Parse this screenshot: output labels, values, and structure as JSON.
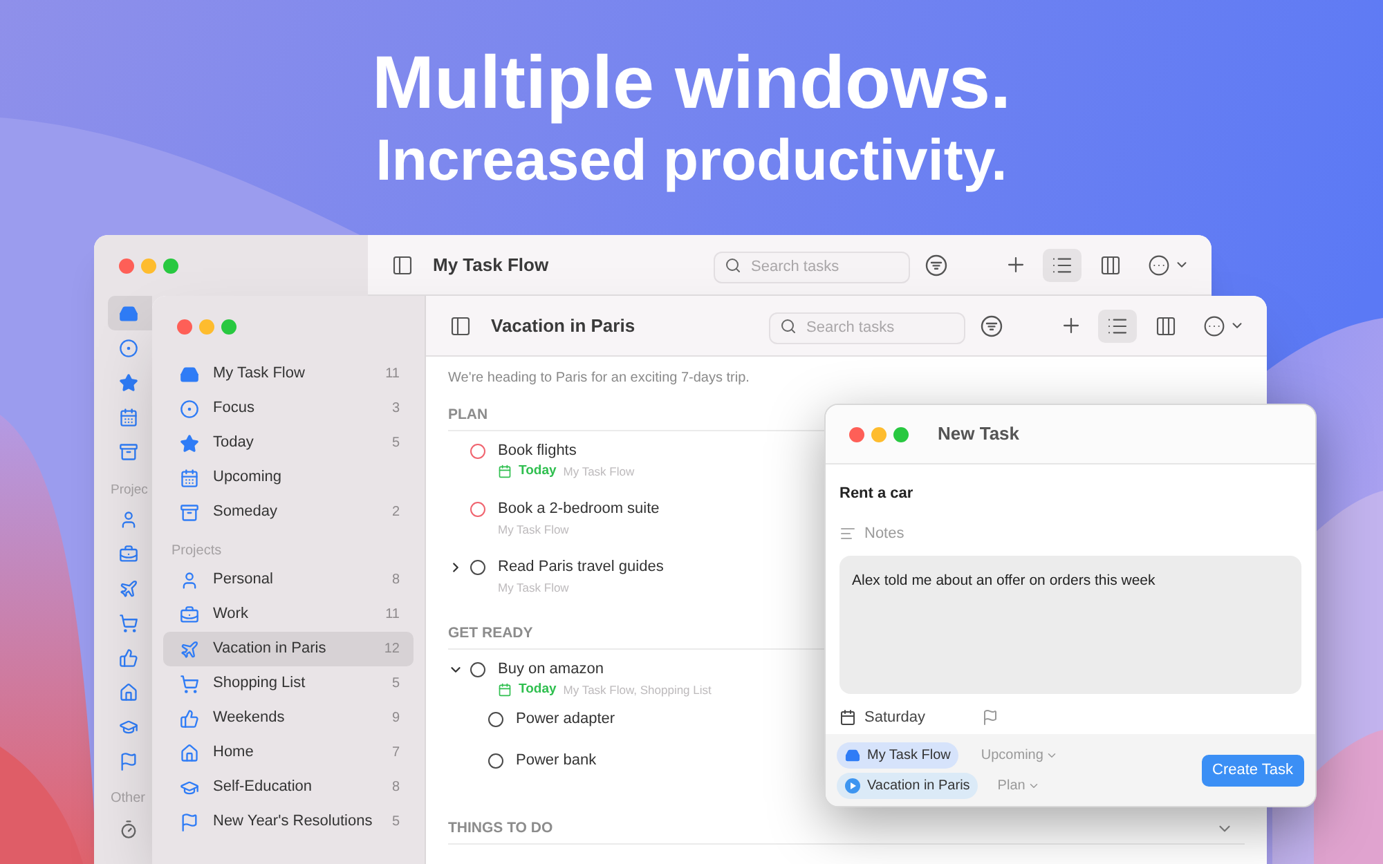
{
  "headline": {
    "title": "Multiple windows.",
    "subtitle": "Increased productivity."
  },
  "back_window": {
    "title": "My Task Flow",
    "search": {
      "placeholder": "Search tasks"
    },
    "views": [
      {
        "selected": true
      },
      {
        "selected": false
      }
    ],
    "sidebar": {
      "lists": [
        {
          "selected": true
        },
        {
          "selected": false
        },
        {
          "selected": false
        },
        {
          "selected": false
        },
        {
          "selected": false
        }
      ],
      "projects_label": "Projec",
      "projects": [
        {
          "selected": false
        },
        {
          "selected": false
        },
        {
          "selected": false
        },
        {
          "selected": false
        },
        {
          "selected": false
        },
        {
          "selected": false
        },
        {
          "selected": false
        },
        {
          "selected": false
        }
      ],
      "other_label": "Other",
      "other": [
        {
          "selected": false
        }
      ]
    }
  },
  "main_window": {
    "title": "Vacation in Paris",
    "search": {
      "placeholder": "Search tasks"
    },
    "views": [
      {
        "selected": true
      },
      {
        "selected": false
      }
    ],
    "sidebar": {
      "lists": [
        {
          "label": "My Task Flow",
          "count": "11",
          "selected": false
        },
        {
          "label": "Focus",
          "count": "3",
          "selected": false
        },
        {
          "label": "Today",
          "count": "5",
          "selected": false
        },
        {
          "label": "Upcoming",
          "selected": false
        },
        {
          "label": "Someday",
          "count": "2",
          "selected": false
        }
      ],
      "projects_label": "Projects",
      "projects": [
        {
          "label": "Personal",
          "count": "8",
          "selected": false
        },
        {
          "label": "Work",
          "count": "11",
          "selected": false
        },
        {
          "label": "Vacation in Paris",
          "count": "12",
          "selected": true
        },
        {
          "label": "Shopping List",
          "count": "5",
          "selected": false
        },
        {
          "label": "Weekends",
          "count": "9",
          "selected": false
        },
        {
          "label": "Home",
          "count": "7",
          "selected": false
        },
        {
          "label": "Self-Education",
          "count": "8",
          "selected": false
        },
        {
          "label": "New Year's Resolutions",
          "count": "5",
          "selected": false
        }
      ]
    },
    "description": "We're heading to Paris for an exciting 7-days trip.",
    "sections": [
      {
        "title": "PLAN",
        "toggle": false,
        "tasks": [
          {
            "title": "Book flights",
            "color": "#f0646f",
            "due": "Today",
            "lists": "My Task Flow"
          },
          {
            "title": "Book a 2-bedroom suite",
            "color": "#f0646f",
            "lists": "My Task Flow"
          },
          {
            "title": "Read Paris travel guides",
            "color": "#4a4a4a",
            "lists": "My Task Flow",
            "expanded": false
          }
        ]
      },
      {
        "title": "GET READY",
        "toggle": false,
        "tasks": [
          {
            "title": "Buy on amazon",
            "color": "#4a4a4a",
            "due": "Today",
            "lists": "My Task Flow, Shopping List",
            "expanded": true,
            "children": [
              {
                "title": "Power adapter",
                "color": "#4a4a4a"
              },
              {
                "title": "Power bank",
                "color": "#4a4a4a"
              }
            ]
          }
        ]
      },
      {
        "title": "THINGS TO DO",
        "toggle": true
      }
    ]
  },
  "new_task": {
    "title": "New Task",
    "name": "Rent a car",
    "notes_label": "Notes",
    "notes": "Alex told me about an offer on orders this week",
    "date": "Saturday",
    "flagged": false,
    "assignments": [
      {
        "kind": "list",
        "project": "My Task Flow",
        "section": "Upcoming"
      },
      {
        "kind": "project",
        "project": "Vacation in Paris",
        "section": "Plan"
      }
    ],
    "submit": "Create Task"
  }
}
